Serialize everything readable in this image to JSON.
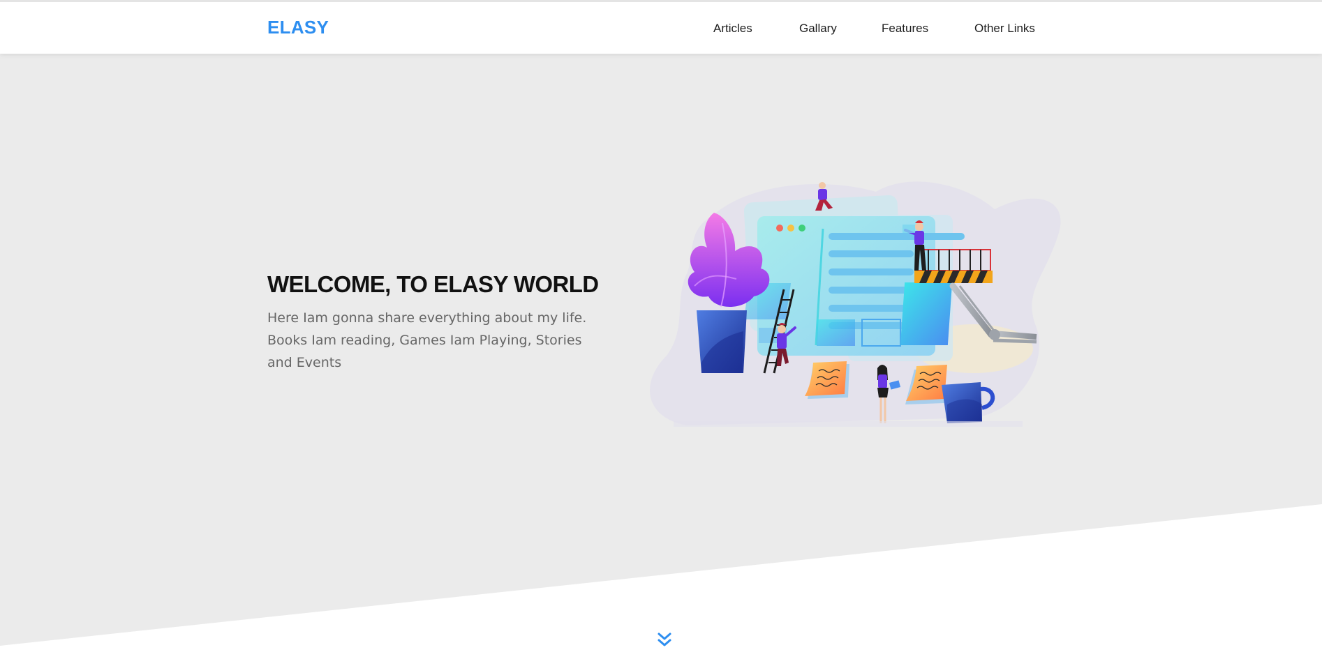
{
  "header": {
    "logo": "ELASY",
    "nav": [
      "Articles",
      "Gallary",
      "Features",
      "Other Links"
    ]
  },
  "hero": {
    "title": "WELCOME, TO ELASY WORLD",
    "text": "Here Iam gonna share everything about my life. Books Iam reading, Games Iam Playing, Stories and Events"
  },
  "icons": {
    "scroll": "double-chevron-down-icon"
  },
  "colors": {
    "brand": "#2d8ef0",
    "hero_bg": "#ebebeb",
    "text_dark": "#111111",
    "text_muted": "#666666"
  }
}
